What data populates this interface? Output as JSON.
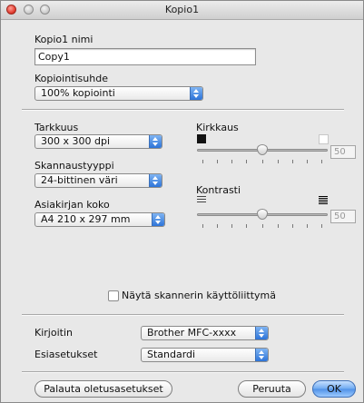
{
  "window": {
    "title": "Kopio1"
  },
  "name_field": {
    "label": "Kopio1 nimi",
    "value": "Copy1"
  },
  "copy_ratio": {
    "label": "Kopiointisuhde",
    "value": "100% kopiointi"
  },
  "resolution": {
    "label": "Tarkkuus",
    "value": "300 x 300 dpi"
  },
  "scan_type": {
    "label": "Skannaustyyppi",
    "value": "24-bittinen väri"
  },
  "document_size": {
    "label": "Asiakirjan koko",
    "value": "A4 210 x 297 mm"
  },
  "brightness": {
    "label": "Kirkkaus",
    "value": "50"
  },
  "contrast": {
    "label": "Kontrasti",
    "value": "50"
  },
  "show_scanner_ui": {
    "label": "Näytä skannerin käyttöliittymä",
    "checked": false
  },
  "printer": {
    "label": "Kirjoitin",
    "value": "Brother MFC-xxxx"
  },
  "presets": {
    "label": "Esiasetukset",
    "value": "Standardi"
  },
  "buttons": {
    "restore_defaults": "Palauta oletusasetukset",
    "cancel": "Peruuta",
    "ok": "OK"
  },
  "colors": {
    "accent": "#4f91e7"
  }
}
